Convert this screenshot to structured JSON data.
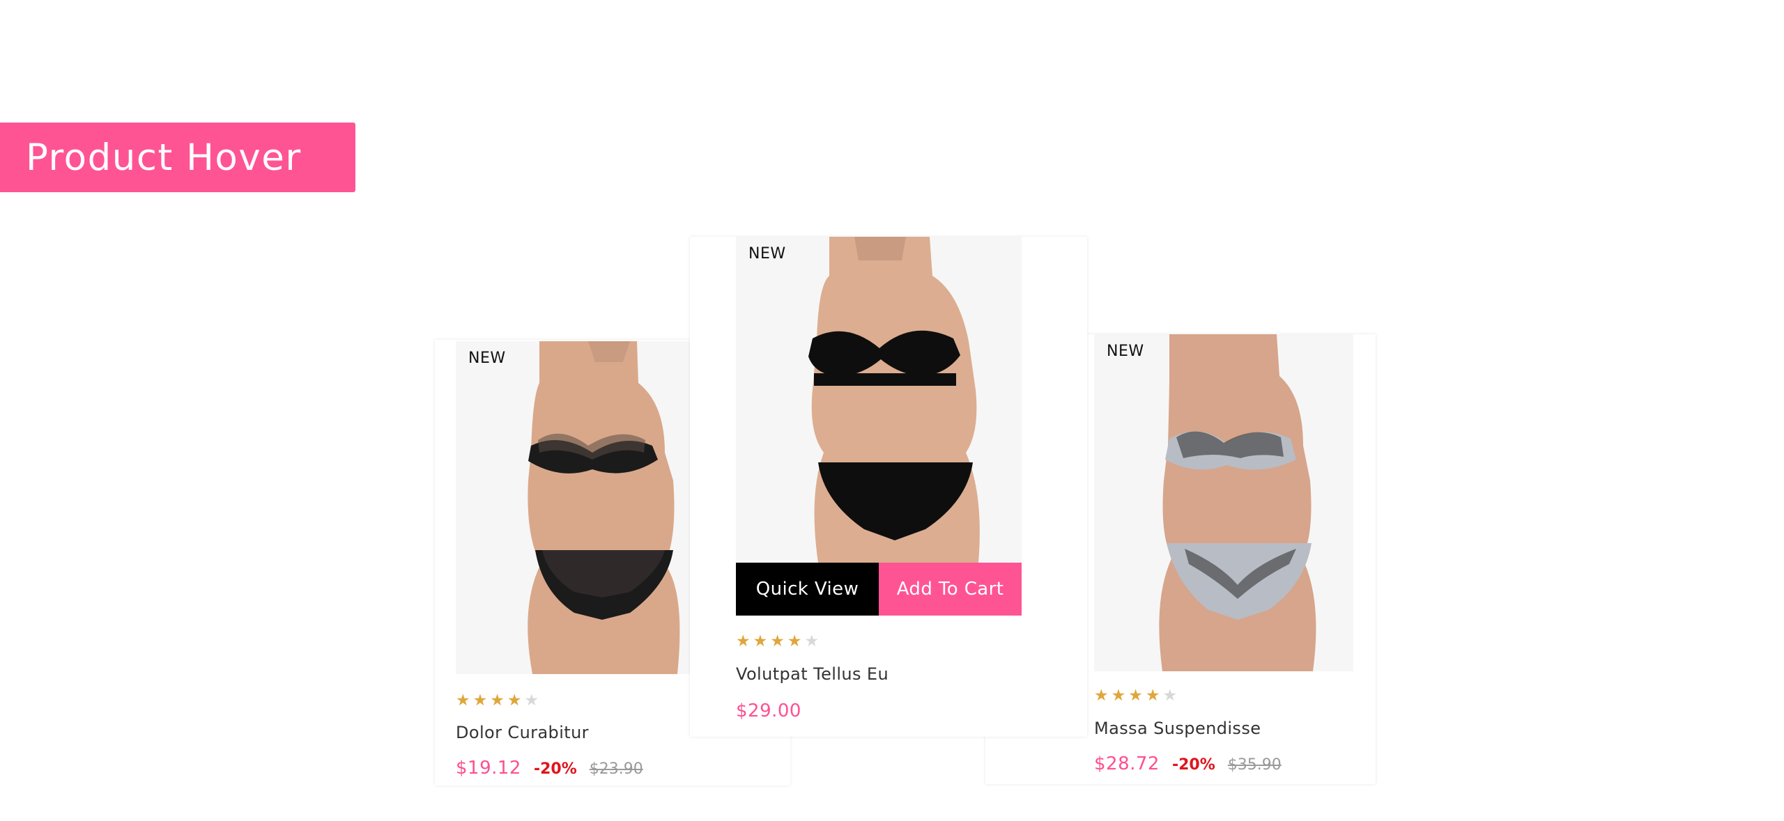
{
  "section": {
    "title": "Product Hover"
  },
  "colors": {
    "accent": "#ff5494",
    "price": "#ff4f91",
    "discount": "#e0141e",
    "star": "#e0a63c"
  },
  "products": [
    {
      "badge": "NEW",
      "name": "Dolor Curabitur",
      "price": "$19.12",
      "discount": "-20%",
      "old_price": "$23.90",
      "rating": 4,
      "rating_max": 5,
      "image": "model-black-lace-lingerie"
    },
    {
      "badge": "NEW",
      "name": "Volutpat Tellus Eu",
      "price": "$29.00",
      "rating": 4,
      "rating_max": 5,
      "image": "model-black-plunge-lingerie",
      "actions": {
        "quick_view": "Quick View",
        "add_to_cart": "Add To Cart"
      }
    },
    {
      "badge": "NEW",
      "name": "Massa Suspendisse",
      "price": "$28.72",
      "discount": "-20%",
      "old_price": "$35.90",
      "rating": 4,
      "rating_max": 5,
      "image": "model-grey-floral-lingerie"
    }
  ]
}
